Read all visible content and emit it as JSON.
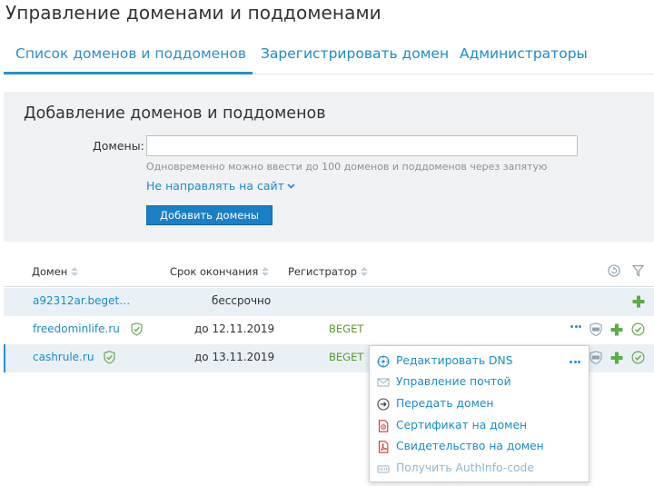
{
  "page": {
    "title": "Управление доменами и поддоменами"
  },
  "tabs": [
    {
      "label": "Список доменов и поддоменов",
      "active": true
    },
    {
      "label": "Зарегистрировать домен",
      "active": false
    },
    {
      "label": "Администраторы",
      "active": false
    }
  ],
  "add_panel": {
    "title": "Добавление доменов и поддоменов",
    "domains_label": "Домены:",
    "domains_value": "",
    "hint": "Одновременно можно ввести до 100 доменов и поддоменов через запятую",
    "redirect_link": "Не направлять на сайт",
    "add_button": "Добавить домены"
  },
  "table": {
    "columns": {
      "domain": "Домен",
      "expiry": "Срок окончания",
      "registrar": "Регистратор"
    },
    "rows": [
      {
        "domain": "a92312ar.beget…",
        "expiry": "бессрочно",
        "registrar": "",
        "verified": false
      },
      {
        "domain": "freedominlife.ru",
        "expiry": "до 12.11.2019",
        "registrar": "BEGET",
        "verified": true
      },
      {
        "domain": "cashrule.ru",
        "expiry": "до 13.11.2019",
        "registrar": "BEGET",
        "verified": true
      }
    ]
  },
  "context_menu": {
    "items": [
      {
        "label": "Редактировать DNS",
        "icon": "dns-icon",
        "enabled": true
      },
      {
        "label": "Управление почтой",
        "icon": "mail-icon",
        "enabled": true
      },
      {
        "label": "Передать домен",
        "icon": "transfer-icon",
        "enabled": true
      },
      {
        "label": "Сертификат на домен",
        "icon": "certificate-pdf-icon",
        "enabled": true
      },
      {
        "label": "Свидетельство на домен",
        "icon": "pdf-icon",
        "enabled": true
      },
      {
        "label": "Получить AuthInfo-code",
        "icon": "authinfo-icon",
        "enabled": false
      }
    ]
  },
  "colors": {
    "link": "#1a8ccd",
    "accent": "#2b8fcf",
    "green": "#5a9a2b",
    "panel_bg": "#f0f2f4",
    "row_highlight": "#eaf1f6",
    "pdf_red": "#d9352f"
  }
}
